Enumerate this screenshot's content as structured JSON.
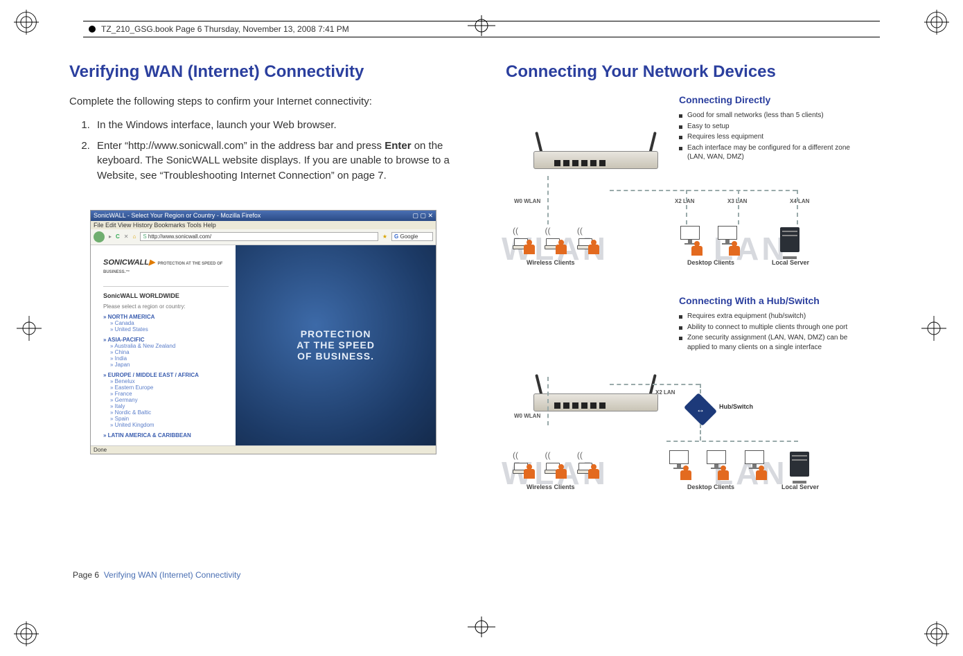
{
  "header_line": "TZ_210_GSG.book  Page 6  Thursday, November 13, 2008  7:41 PM",
  "left": {
    "heading": "Verifying WAN (Internet) Connectivity",
    "intro": "Complete the following steps to confirm your Internet connectivity:",
    "steps": [
      "In the Windows interface, launch your Web browser.",
      "Enter “http://www.sonicwall.com” in the address bar and press Enter on the keyboard. The SonicWALL website displays. If you are unable to browse to a Website, see “Troubleshooting Internet Connection” on page 7."
    ],
    "step2_bold": "Enter",
    "screenshot": {
      "title": "SonicWALL - Select Your Region or Country - Mozilla Firefox",
      "menu": "File   Edit   View   History   Bookmarks   Tools   Help",
      "url": "http://www.sonicwall.com/",
      "search_placeholder": "Google",
      "logo": "SONICWALL",
      "logo_tag": "PROTECTION AT THE SPEED OF BUSINESS.™",
      "worldwide": "SonicWALL WORLDWIDE",
      "prompt": "Please select a region or country:",
      "regions": [
        {
          "name": "NORTH AMERICA",
          "subs": [
            "Canada",
            "United States"
          ]
        },
        {
          "name": "ASIA-PACIFIC",
          "subs": [
            "Australia & New Zealand",
            "China",
            "India",
            "Japan"
          ]
        },
        {
          "name": "EUROPE / MIDDLE EAST / AFRICA",
          "subs": [
            "Benelux",
            "Eastern Europe",
            "France",
            "Germany",
            "Italy",
            "Nordic & Baltic",
            "Spain",
            "United Kingdom"
          ]
        },
        {
          "name": "LATIN AMERICA & CARIBBEAN",
          "subs": []
        }
      ],
      "hero1": "PROTECTION",
      "hero2": "AT THE SPEED",
      "hero3": "OF BUSINESS.",
      "status": "Done"
    }
  },
  "right": {
    "heading": "Connecting Your Network Devices",
    "direct": {
      "title": "Connecting Directly",
      "bullets": [
        "Good for small networks (less than 5 clients)",
        "Easy to setup",
        "Requires less equipment",
        "Each interface may be configured for a different zone (LAN, WAN, DMZ)"
      ],
      "ports": {
        "w0": "W0 WLAN",
        "x2": "X2 LAN",
        "x3": "X3 LAN",
        "x4": "X4 LAN"
      },
      "labels": {
        "wlan_bg": "WLAN",
        "lan_bg": "LAN",
        "wireless": "Wireless Clients",
        "desktop": "Desktop Clients",
        "server": "Local Server"
      }
    },
    "hub": {
      "title": "Connecting With a Hub/Switch",
      "bullets": [
        "Requires extra equipment (hub/switch)",
        "Ability to connect to multiple clients through one port",
        "Zone security assignment (LAN, WAN, DMZ) can be applied to many clients on a single interface"
      ],
      "ports": {
        "w0": "W0 WLAN",
        "x2": "X2 LAN"
      },
      "hubswitch": "Hub/Switch",
      "labels": {
        "wlan_bg": "WLAN",
        "lan_bg": "LAN",
        "wireless": "Wireless Clients",
        "desktop": "Desktop Clients",
        "server": "Local Server"
      }
    }
  },
  "footer": {
    "page": "Page 6",
    "section": "Verifying WAN (Internet) Connectivity"
  }
}
